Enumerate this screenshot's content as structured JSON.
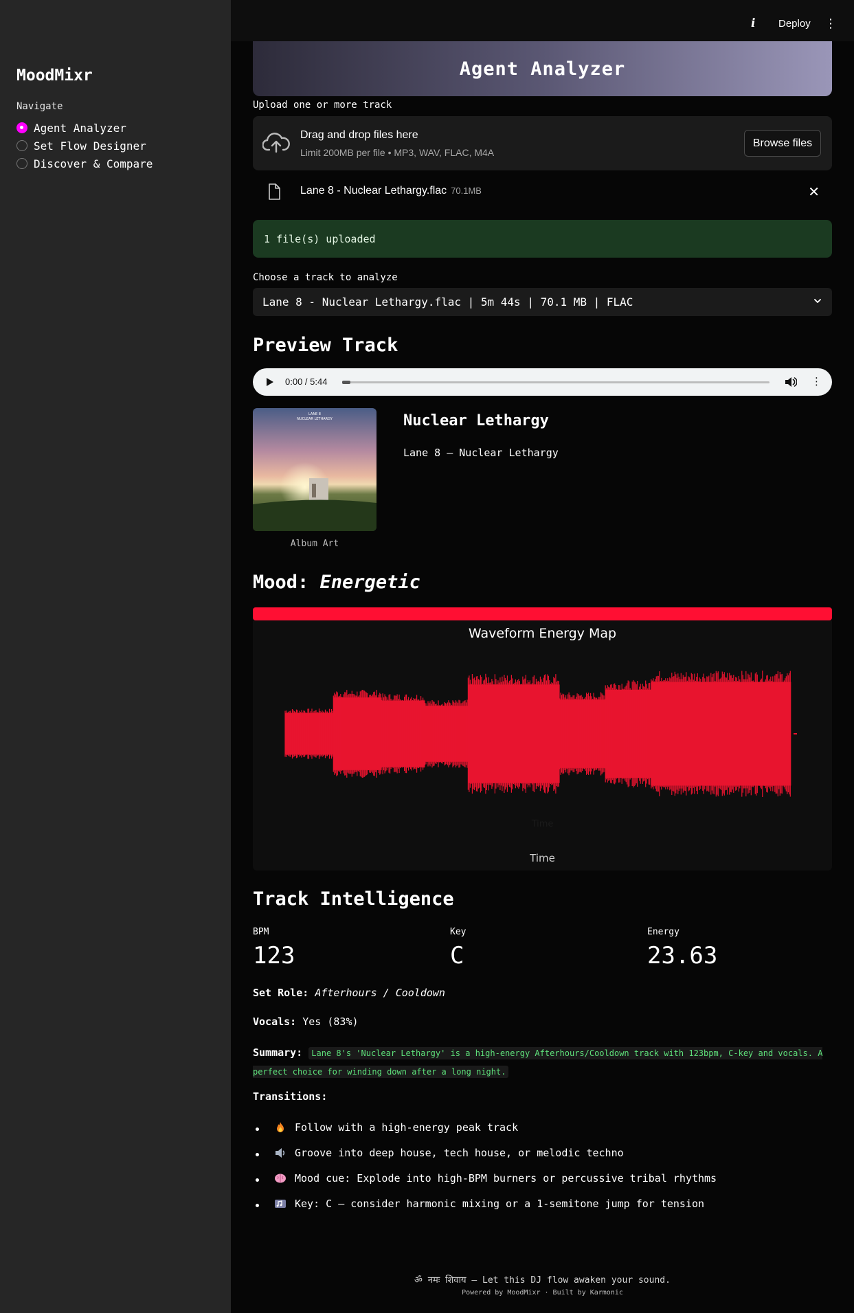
{
  "sidebar": {
    "brand": "MoodMixr",
    "nav_label": "Navigate",
    "items": [
      {
        "label": "Agent Analyzer",
        "selected": true
      },
      {
        "label": "Set Flow Designer",
        "selected": false
      },
      {
        "label": "Discover & Compare",
        "selected": false
      }
    ]
  },
  "topbar": {
    "info_icon": "info-icon",
    "deploy_label": "Deploy",
    "menu_icon": "kebab-menu-icon"
  },
  "header": {
    "title": "Agent Analyzer"
  },
  "uploader": {
    "label": "Upload one or more track",
    "drop_title": "Drag and drop files here",
    "drop_sub": "Limit 200MB per file • MP3, WAV, FLAC, M4A",
    "browse_label": "Browse files",
    "file_name": "Lane 8 - Nuclear Lethargy.flac",
    "file_size": "70.1MB",
    "success_msg": "1 file(s) uploaded"
  },
  "track_select": {
    "label": "Choose a track to analyze",
    "value": "Lane 8 - Nuclear Lethargy.flac | 5m 44s | 70.1 MB | FLAC"
  },
  "preview": {
    "heading": "Preview Track",
    "time": "0:00 / 5:44",
    "progress": 0.0
  },
  "track": {
    "title": "Nuclear Lethargy",
    "artist_line": "Lane 8 — Nuclear Lethargy",
    "art_caption": "Album Art",
    "art_text_line1": "LANE 8",
    "art_text_line2": "NUCLEAR LETHARGY"
  },
  "mood": {
    "label": "Mood:",
    "value": "Energetic",
    "color": "#ff0f33"
  },
  "chart_data": {
    "type": "area",
    "title": "Waveform Energy Map",
    "xlabel": "Time",
    "color": "#e8142f",
    "segments": [
      {
        "start": 0.0,
        "end": 0.095,
        "amp": 0.4
      },
      {
        "start": 0.095,
        "end": 0.19,
        "amp": 0.7
      },
      {
        "start": 0.19,
        "end": 0.275,
        "amp": 0.64
      },
      {
        "start": 0.275,
        "end": 0.36,
        "amp": 0.54
      },
      {
        "start": 0.36,
        "end": 0.54,
        "amp": 0.95
      },
      {
        "start": 0.54,
        "end": 0.63,
        "amp": 0.66
      },
      {
        "start": 0.63,
        "end": 0.72,
        "amp": 0.85
      },
      {
        "start": 0.72,
        "end": 0.995,
        "amp": 1.0
      }
    ]
  },
  "intelligence": {
    "heading": "Track Intelligence",
    "bpm_label": "BPM",
    "bpm": "123",
    "key_label": "Key",
    "key": "C",
    "energy_label": "Energy",
    "energy": "23.63",
    "set_role_label": "Set Role:",
    "set_role": "Afterhours / Cooldown",
    "vocals_label": "Vocals:",
    "vocals": "Yes (83%)",
    "summary_label": "Summary:",
    "summary": "Lane 8's 'Nuclear Lethargy' is a high-energy Afterhours/Cooldown track with 123bpm, C-key and vocals. A perfect choice for winding down after a long night.",
    "transitions_label": "Transitions:",
    "transitions": [
      {
        "icon": "fire-icon",
        "text": "Follow with a high-energy peak track"
      },
      {
        "icon": "speaker-icon",
        "text": "Groove into deep house, tech house, or melodic techno"
      },
      {
        "icon": "brain-icon",
        "text": "Mood cue: Explode into high-BPM burners or percussive tribal rhythms"
      },
      {
        "icon": "music-keys-icon",
        "text": "Key: C — consider harmonic mixing or a 1-semitone jump for tension"
      }
    ]
  },
  "footer": {
    "line1": "ॐ नमः शिवाय — Let this DJ flow awaken your sound.",
    "line2": "Powered by MoodMixr · Built by Karmonic"
  }
}
